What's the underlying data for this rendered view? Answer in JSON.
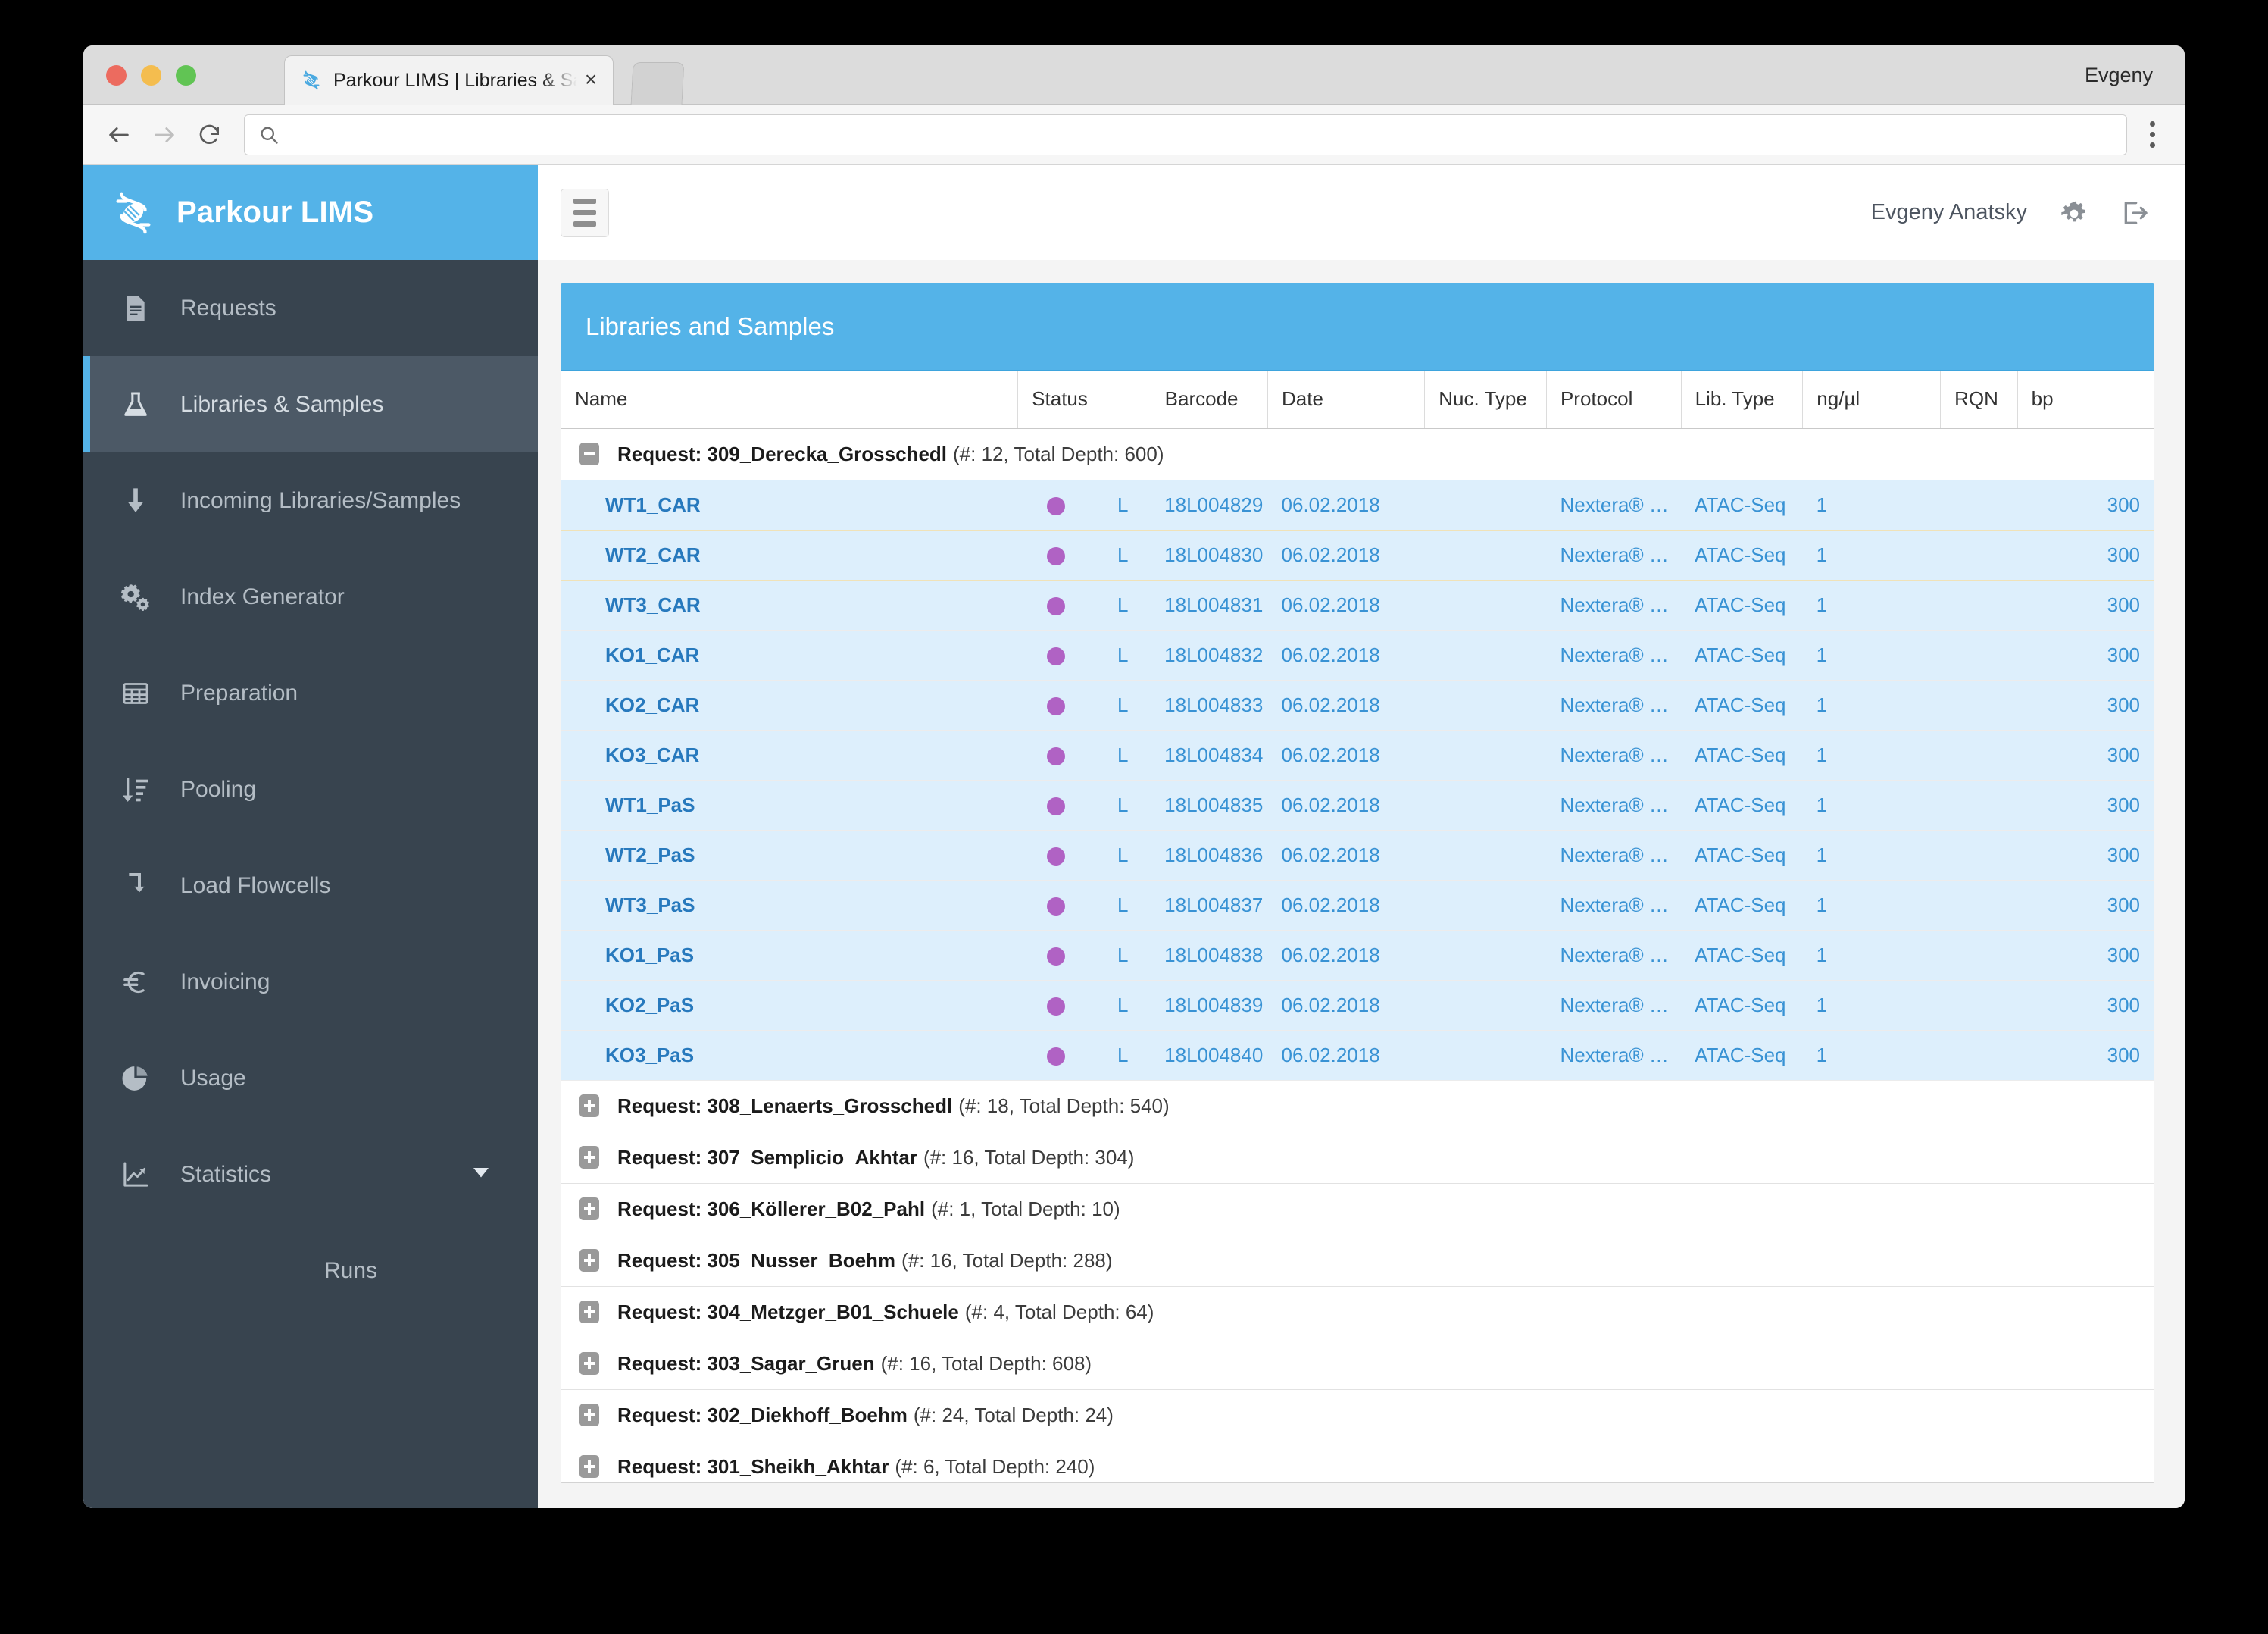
{
  "browser": {
    "tab_title": "Parkour LIMS | Libraries & Sam",
    "tab_close": "×",
    "window_user": "Evgeny",
    "omnibox_value": "",
    "omnibox_placeholder": ""
  },
  "sidebar": {
    "brand": "Parkour LIMS",
    "items": [
      {
        "label": "Requests",
        "icon": "document-icon",
        "active": false
      },
      {
        "label": "Libraries & Samples",
        "icon": "flask-icon",
        "active": true
      },
      {
        "label": "Incoming Libraries/Samples",
        "icon": "arrow-down-icon",
        "active": false
      },
      {
        "label": "Index Generator",
        "icon": "gears-icon",
        "active": false
      },
      {
        "label": "Preparation",
        "icon": "table-icon",
        "active": false
      },
      {
        "label": "Pooling",
        "icon": "sort-amount-icon",
        "active": false
      },
      {
        "label": "Load Flowcells",
        "icon": "arrow-turn-down-icon",
        "active": false
      },
      {
        "label": "Invoicing",
        "icon": "euro-icon",
        "active": false
      },
      {
        "label": "Usage",
        "icon": "pie-chart-icon",
        "active": false
      },
      {
        "label": "Statistics",
        "icon": "line-chart-icon",
        "active": false,
        "expandable": true
      }
    ],
    "sub_items": [
      {
        "label": "Runs",
        "parent": "Statistics"
      }
    ]
  },
  "topbar": {
    "menu_toggle": "menu-toggle",
    "user_name": "Evgeny Anatsky",
    "settings_icon": "gear-icon",
    "logout_icon": "logout-icon"
  },
  "panel": {
    "title": "Libraries and Samples",
    "columns": [
      "Name",
      "Status",
      "",
      "Barcode",
      "Date",
      "Nuc. Type",
      "Protocol",
      "Lib. Type",
      "ng/µl",
      "RQN",
      "bp"
    ],
    "groups": [
      {
        "expanded": true,
        "title": "Request: 309_Derecka_Grosschedl",
        "meta": "(#: 12, Total Depth: 600)",
        "rows": [
          {
            "name": "WT1_CAR",
            "status": "purple",
            "letter": "L",
            "barcode": "18L004829",
            "date": "06.02.2018",
            "nuc_type": "",
            "protocol": "Nextera® …",
            "lib_type": "ATAC-Seq",
            "ng_ul": "1",
            "rqn": "",
            "bp": "300"
          },
          {
            "name": "WT2_CAR",
            "status": "purple",
            "letter": "L",
            "barcode": "18L004830",
            "date": "06.02.2018",
            "nuc_type": "",
            "protocol": "Nextera® …",
            "lib_type": "ATAC-Seq",
            "ng_ul": "1",
            "rqn": "",
            "bp": "300"
          },
          {
            "name": "WT3_CAR",
            "status": "purple",
            "letter": "L",
            "barcode": "18L004831",
            "date": "06.02.2018",
            "nuc_type": "",
            "protocol": "Nextera® …",
            "lib_type": "ATAC-Seq",
            "ng_ul": "1",
            "rqn": "",
            "bp": "300"
          },
          {
            "name": "KO1_CAR",
            "status": "purple",
            "letter": "L",
            "barcode": "18L004832",
            "date": "06.02.2018",
            "nuc_type": "",
            "protocol": "Nextera® …",
            "lib_type": "ATAC-Seq",
            "ng_ul": "1",
            "rqn": "",
            "bp": "300"
          },
          {
            "name": "KO2_CAR",
            "status": "purple",
            "letter": "L",
            "barcode": "18L004833",
            "date": "06.02.2018",
            "nuc_type": "",
            "protocol": "Nextera® …",
            "lib_type": "ATAC-Seq",
            "ng_ul": "1",
            "rqn": "",
            "bp": "300"
          },
          {
            "name": "KO3_CAR",
            "status": "purple",
            "letter": "L",
            "barcode": "18L004834",
            "date": "06.02.2018",
            "nuc_type": "",
            "protocol": "Nextera® …",
            "lib_type": "ATAC-Seq",
            "ng_ul": "1",
            "rqn": "",
            "bp": "300"
          },
          {
            "name": "WT1_PaS",
            "status": "purple",
            "letter": "L",
            "barcode": "18L004835",
            "date": "06.02.2018",
            "nuc_type": "",
            "protocol": "Nextera® …",
            "lib_type": "ATAC-Seq",
            "ng_ul": "1",
            "rqn": "",
            "bp": "300"
          },
          {
            "name": "WT2_PaS",
            "status": "purple",
            "letter": "L",
            "barcode": "18L004836",
            "date": "06.02.2018",
            "nuc_type": "",
            "protocol": "Nextera® …",
            "lib_type": "ATAC-Seq",
            "ng_ul": "1",
            "rqn": "",
            "bp": "300"
          },
          {
            "name": "WT3_PaS",
            "status": "purple",
            "letter": "L",
            "barcode": "18L004837",
            "date": "06.02.2018",
            "nuc_type": "",
            "protocol": "Nextera® …",
            "lib_type": "ATAC-Seq",
            "ng_ul": "1",
            "rqn": "",
            "bp": "300"
          },
          {
            "name": "KO1_PaS",
            "status": "purple",
            "letter": "L",
            "barcode": "18L004838",
            "date": "06.02.2018",
            "nuc_type": "",
            "protocol": "Nextera® …",
            "lib_type": "ATAC-Seq",
            "ng_ul": "1",
            "rqn": "",
            "bp": "300"
          },
          {
            "name": "KO2_PaS",
            "status": "purple",
            "letter": "L",
            "barcode": "18L004839",
            "date": "06.02.2018",
            "nuc_type": "",
            "protocol": "Nextera® …",
            "lib_type": "ATAC-Seq",
            "ng_ul": "1",
            "rqn": "",
            "bp": "300"
          },
          {
            "name": "KO3_PaS",
            "status": "purple",
            "letter": "L",
            "barcode": "18L004840",
            "date": "06.02.2018",
            "nuc_type": "",
            "protocol": "Nextera® …",
            "lib_type": "ATAC-Seq",
            "ng_ul": "1",
            "rqn": "",
            "bp": "300"
          }
        ]
      },
      {
        "expanded": false,
        "title": "Request: 308_Lenaerts_Grosschedl",
        "meta": "(#: 18, Total Depth: 540)",
        "rows": []
      },
      {
        "expanded": false,
        "title": "Request: 307_Semplicio_Akhtar",
        "meta": "(#: 16, Total Depth: 304)",
        "rows": []
      },
      {
        "expanded": false,
        "title": "Request: 306_Köllerer_B02_Pahl",
        "meta": "(#: 1, Total Depth: 10)",
        "rows": []
      },
      {
        "expanded": false,
        "title": "Request: 305_Nusser_Boehm",
        "meta": "(#: 16, Total Depth: 288)",
        "rows": []
      },
      {
        "expanded": false,
        "title": "Request: 304_Metzger_B01_Schuele",
        "meta": "(#: 4, Total Depth: 64)",
        "rows": []
      },
      {
        "expanded": false,
        "title": "Request: 303_Sagar_Gruen",
        "meta": "(#: 16, Total Depth: 608)",
        "rows": []
      },
      {
        "expanded": false,
        "title": "Request: 302_Diekhoff_Boehm",
        "meta": "(#: 24, Total Depth: 24)",
        "rows": []
      },
      {
        "expanded": false,
        "title": "Request: 301_Sheikh_Akhtar",
        "meta": "(#: 6, Total Depth: 240)",
        "rows": []
      }
    ]
  },
  "colors": {
    "brand_blue": "#54b3e8",
    "sidebar_dark": "#38444f",
    "sidebar_active": "#4c5966",
    "row_blue": "#ddeffc",
    "link_blue": "#3892d4",
    "status_purple": "#b062c4"
  }
}
